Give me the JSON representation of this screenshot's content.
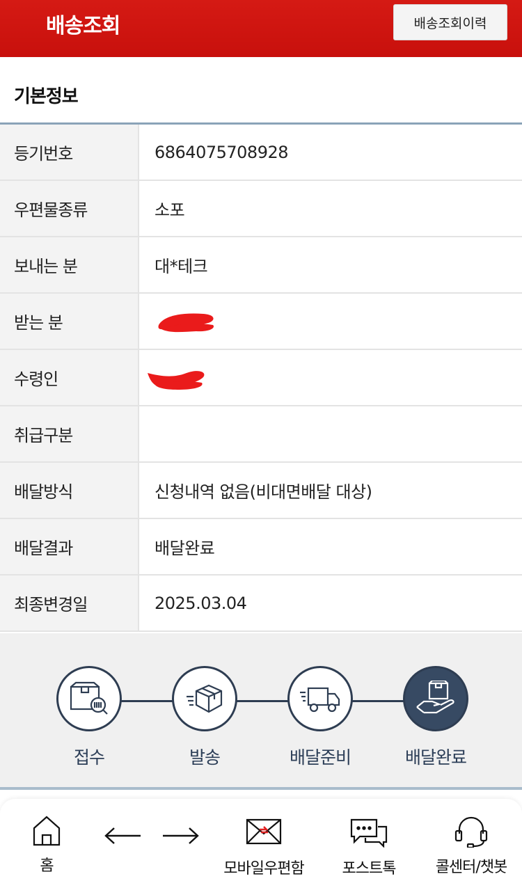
{
  "header": {
    "title": "배송조회",
    "history_button": "배송조회이력",
    "color": "#d0140f"
  },
  "section": {
    "title": "기본정보"
  },
  "info_rows": [
    {
      "label": "등기번호",
      "value": "6864075708928"
    },
    {
      "label": "우편물종류",
      "value": "소포"
    },
    {
      "label": "보내는 분",
      "value": "대*테크"
    },
    {
      "label": "받는 분",
      "value": "",
      "redacted": true
    },
    {
      "label": "수령인",
      "value": "",
      "redacted": true
    },
    {
      "label": "취급구분",
      "value": ""
    },
    {
      "label": "배달방식",
      "value": "신청내역 없음(비대면배달 대상)"
    },
    {
      "label": "배달결과",
      "value": "배달완료"
    },
    {
      "label": "최종변경일",
      "value": "2025.03.04"
    }
  ],
  "steps": [
    {
      "label": "접수",
      "icon": "box-scan-icon",
      "active": false
    },
    {
      "label": "발송",
      "icon": "box-send-icon",
      "active": false
    },
    {
      "label": "배달준비",
      "icon": "truck-icon",
      "active": false
    },
    {
      "label": "배달완료",
      "icon": "hand-box-icon",
      "active": true
    }
  ],
  "bottom_nav": {
    "home": "홈",
    "back_icon": "arrow-left-icon",
    "forward_icon": "arrow-right-icon",
    "mailbox": "모바일우편함",
    "posttalk": "포스트톡",
    "callcenter": "콜센터/챗봇"
  }
}
